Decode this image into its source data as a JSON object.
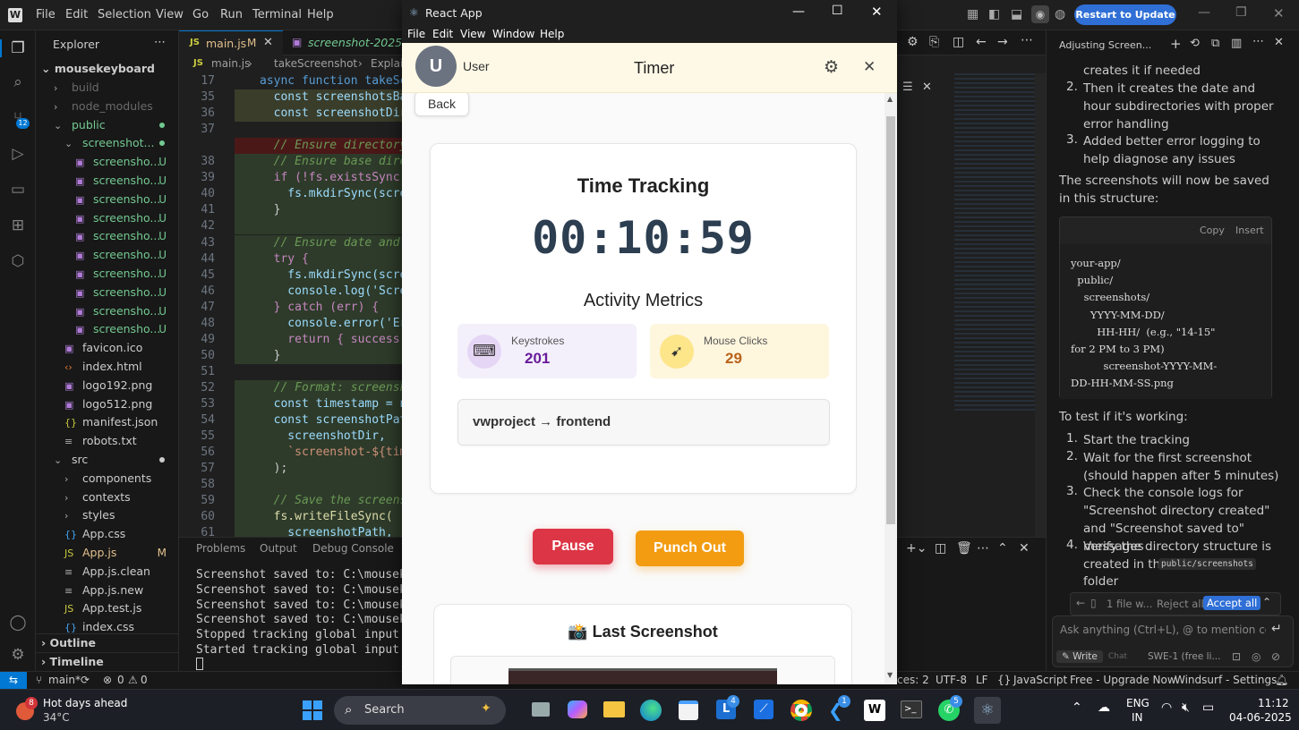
{
  "vscode": {
    "menu": [
      "File",
      "Edit",
      "Selection",
      "View",
      "Go",
      "Run",
      "Terminal",
      "Help"
    ],
    "restart_button": "Restart to Update →",
    "explorer": {
      "title": "Explorer",
      "project": "mousekeyboard",
      "rows": [
        {
          "label": "build",
          "indent": 1,
          "type": "folder-closed",
          "color": "#6a6a6a"
        },
        {
          "label": "node_modules",
          "indent": 1,
          "type": "folder-closed",
          "color": "#6a6a6a"
        },
        {
          "label": "public",
          "indent": 1,
          "type": "folder-open",
          "color": "#73c991",
          "dot": true
        },
        {
          "label": "screenshot...",
          "indent": 2,
          "type": "folder-open",
          "color": "#73c991",
          "dot": true
        },
        {
          "label": "screensho...",
          "indent": 3,
          "type": "img",
          "color": "#73c991",
          "badge": "U"
        },
        {
          "label": "screensho...",
          "indent": 3,
          "type": "img",
          "color": "#73c991",
          "badge": "U"
        },
        {
          "label": "screensho...",
          "indent": 3,
          "type": "img",
          "color": "#73c991",
          "badge": "U"
        },
        {
          "label": "screensho...",
          "indent": 3,
          "type": "img",
          "color": "#73c991",
          "badge": "U"
        },
        {
          "label": "screensho...",
          "indent": 3,
          "type": "img",
          "color": "#73c991",
          "badge": "U"
        },
        {
          "label": "screensho...",
          "indent": 3,
          "type": "img",
          "color": "#73c991",
          "badge": "U"
        },
        {
          "label": "screensho...",
          "indent": 3,
          "type": "img",
          "color": "#73c991",
          "badge": "U"
        },
        {
          "label": "screensho...",
          "indent": 3,
          "type": "img",
          "color": "#73c991",
          "badge": "U"
        },
        {
          "label": "screensho...",
          "indent": 3,
          "type": "img",
          "color": "#73c991",
          "badge": "U"
        },
        {
          "label": "screensho...",
          "indent": 3,
          "type": "img",
          "color": "#73c991",
          "badge": "U"
        },
        {
          "label": "favicon.ico",
          "indent": 2,
          "type": "img",
          "color": "#cccccc"
        },
        {
          "label": "index.html",
          "indent": 2,
          "type": "html",
          "color": "#cccccc"
        },
        {
          "label": "logo192.png",
          "indent": 2,
          "type": "img",
          "color": "#cccccc"
        },
        {
          "label": "logo512.png",
          "indent": 2,
          "type": "img",
          "color": "#cccccc"
        },
        {
          "label": "manifest.json",
          "indent": 2,
          "type": "json",
          "color": "#cccccc"
        },
        {
          "label": "robots.txt",
          "indent": 2,
          "type": "txt",
          "color": "#cccccc"
        },
        {
          "label": "src",
          "indent": 1,
          "type": "folder-open",
          "color": "#cccccc",
          "dot": true
        },
        {
          "label": "components",
          "indent": 2,
          "type": "folder-closed",
          "color": "#cccccc"
        },
        {
          "label": "contexts",
          "indent": 2,
          "type": "folder-closed",
          "color": "#cccccc"
        },
        {
          "label": "styles",
          "indent": 2,
          "type": "folder-closed",
          "color": "#cccccc"
        },
        {
          "label": "App.css",
          "indent": 2,
          "type": "css",
          "color": "#cccccc"
        },
        {
          "label": "App.js",
          "indent": 2,
          "type": "js",
          "color": "#e2c08d",
          "badge": "M"
        },
        {
          "label": "App.js.clean",
          "indent": 2,
          "type": "txt",
          "color": "#cccccc"
        },
        {
          "label": "App.js.new",
          "indent": 2,
          "type": "txt",
          "color": "#cccccc"
        },
        {
          "label": "App.test.js",
          "indent": 2,
          "type": "js",
          "color": "#cccccc"
        },
        {
          "label": "index.css",
          "indent": 2,
          "type": "css",
          "color": "#cccccc"
        }
      ],
      "outline": "Outline",
      "timeline": "Timeline"
    },
    "tabs": [
      {
        "label": "main.js",
        "badge": "M",
        "active": true
      },
      {
        "label": "screenshot-2025-06",
        "active": false
      }
    ],
    "breadcrumb": [
      "main.js",
      "takeScreenshot",
      "Explain"
    ],
    "code_lines": [
      {
        "n": "17",
        "t": "async function takeScreens",
        "c": "#569cd6"
      },
      {
        "n": "35",
        "t": "  const screenshotsBaseD",
        "c": "#9cdcfe"
      },
      {
        "n": "36",
        "t": "  const screenshotDir = ",
        "c": "#9cdcfe"
      },
      {
        "n": "37",
        "t": "",
        "c": "#ccc"
      },
      {
        "n": "",
        "t": "  // Ensure directory ex",
        "c": "#6a9955",
        "removed": true
      },
      {
        "n": "38",
        "t": "  // Ensure base directo",
        "c": "#6a9955"
      },
      {
        "n": "39",
        "t": "  if (!fs.existsSync(scr",
        "c": "#c586c0"
      },
      {
        "n": "40",
        "t": "    fs.mkdirSync(screens",
        "c": "#9cdcfe"
      },
      {
        "n": "41",
        "t": "  }",
        "c": "#ccc"
      },
      {
        "n": "42",
        "t": "",
        "c": "#ccc"
      },
      {
        "n": "43",
        "t": "  // Ensure date and hou",
        "c": "#6a9955"
      },
      {
        "n": "44",
        "t": "  try {",
        "c": "#c586c0"
      },
      {
        "n": "45",
        "t": "    fs.mkdirSync(screens",
        "c": "#9cdcfe"
      },
      {
        "n": "46",
        "t": "    console.log('Screens",
        "c": "#9cdcfe"
      },
      {
        "n": "47",
        "t": "  } catch (err) {",
        "c": "#c586c0"
      },
      {
        "n": "48",
        "t": "    console.error('Error",
        "c": "#9cdcfe"
      },
      {
        "n": "49",
        "t": "    return { success: fa",
        "c": "#c586c0"
      },
      {
        "n": "50",
        "t": "  }",
        "c": "#ccc"
      },
      {
        "n": "51",
        "t": "",
        "c": "#ccc"
      },
      {
        "n": "52",
        "t": "  // Format: screenshot-",
        "c": "#6a9955"
      },
      {
        "n": "53",
        "t": "  const timestamp = now.",
        "c": "#9cdcfe"
      },
      {
        "n": "54",
        "t": "  const screenshotPath =",
        "c": "#9cdcfe"
      },
      {
        "n": "55",
        "t": "    screenshotDir,",
        "c": "#9cdcfe"
      },
      {
        "n": "56",
        "t": "    `screenshot-${timest",
        "c": "#ce9178"
      },
      {
        "n": "57",
        "t": "  );",
        "c": "#ccc"
      },
      {
        "n": "58",
        "t": "",
        "c": "#ccc"
      },
      {
        "n": "59",
        "t": "  // Save the screenshot",
        "c": "#6a9955"
      },
      {
        "n": "60",
        "t": "  fs.writeFileSync(",
        "c": "#dcdcaa"
      },
      {
        "n": "61",
        "t": "    screenshotPath,",
        "c": "#9cdcfe"
      }
    ],
    "panel_tabs": [
      "Problems",
      "Output",
      "Debug Console"
    ],
    "terminal": [
      "Screenshot saved to: C:\\mousekeybo",
      "Screenshot saved to: C:\\mousekeybo",
      "Screenshot saved to: C:\\mousekeybo",
      "Screenshot saved to: C:\\mousekeybo",
      "Stopped tracking global input even",
      "Started tracking global input even"
    ],
    "chat": {
      "title": "Adjusting Screen...",
      "items_top": [
        {
          "num": "",
          "text": "creates it if needed"
        },
        {
          "num": "2.",
          "text": "Then it creates the date and hour subdirectories with proper error handling"
        },
        {
          "num": "3.",
          "text": "Added better error logging to help diagnose any issues"
        }
      ],
      "para": "The screenshots will now be saved in this structure:",
      "code_copy": "Copy",
      "code_insert": "Insert",
      "code_lines": [
        "your-app/",
        "  public/",
        "    screenshots/",
        "      YYYY-MM-DD/",
        "        HH-HH/  (e.g., \"14-15\"",
        "for 2 PM to 3 PM)",
        "          screenshot-YYYY-MM-",
        "DD-HH-MM-SS.png"
      ],
      "test_heading": "To test if it's working:",
      "steps": [
        {
          "num": "1.",
          "text": "Start the tracking"
        },
        {
          "num": "2.",
          "text": "Wait for the first screenshot (should happen after 5 minutes)"
        },
        {
          "num": "3.",
          "text": "Check the console logs for \"Screenshot directory created\" and \"Screenshot saved to\" messages"
        },
        {
          "num": "4.",
          "text": "Verify the directory structure is created in the"
        }
      ],
      "inline_code": "public/screenshots",
      "folder_word": "folder",
      "files_bar": "1 file w...",
      "reject_all": "Reject all",
      "accept_all": "Accept all",
      "input_placeholder": "Ask anything (Ctrl+L), @ to mention code b",
      "write": "Write",
      "chat_mode": "Chat",
      "model": "SWE-1 (free li..."
    },
    "status": {
      "branch": "main*",
      "errors": "0",
      "warnings": "0",
      "spaces": "ces: 2",
      "encoding": "UTF-8",
      "eol": "LF",
      "language": "JavaScript",
      "upgrade": "Free - Upgrade Now",
      "settings": "Windsurf - Settings"
    }
  },
  "react_app": {
    "window_title": "React App",
    "menu": [
      "File",
      "Edit",
      "View",
      "Window",
      "Help"
    ],
    "avatar_initial": "U",
    "user_name": "User",
    "header_title": "Timer",
    "back_label": "Back",
    "tracking_title": "Time Tracking",
    "timer": "00:10:59",
    "metrics_title": "Activity Metrics",
    "keystrokes_label": "Keystrokes",
    "keystrokes_value": "201",
    "clicks_label": "Mouse Clicks",
    "clicks_value": "29",
    "project_path": "vwproject → frontend",
    "pause_label": "Pause",
    "punch_out_label": "Punch Out",
    "last_screenshot_title": "📸 Last Screenshot",
    "colors": {
      "pause": "#dc3545",
      "punch_out": "#f39c12",
      "keystrokes_bg": "#f3f0fb",
      "clicks_bg": "#fef6dd",
      "value_purple": "#6a1b9a",
      "value_orange": "#b9621a"
    }
  },
  "taskbar": {
    "weather_badge": "8",
    "weather_title": "Hot days ahead",
    "weather_temp": "34°C",
    "search": "Search",
    "badges": {
      "l": "4",
      "vscode": "1",
      "whatsapp": "5"
    },
    "lang": "ENG",
    "region": "IN",
    "time": "11:12",
    "date": "04-06-2025"
  }
}
